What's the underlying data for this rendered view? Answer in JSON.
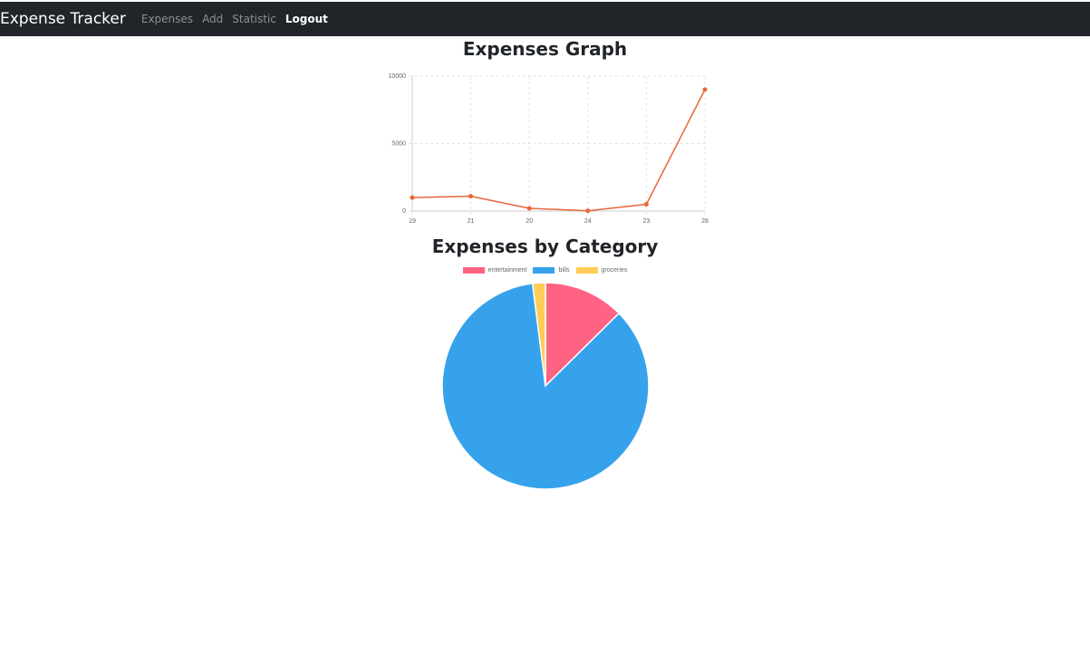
{
  "navbar": {
    "brand": "Expense Tracker",
    "links": [
      {
        "label": "Expenses"
      },
      {
        "label": "Add"
      },
      {
        "label": "Statistic"
      },
      {
        "label": "Logout"
      }
    ],
    "bg_color": "#212529"
  },
  "line_section": {
    "title": "Expenses Graph"
  },
  "pie_section": {
    "title": "Expenses by Category"
  },
  "chart_data": [
    {
      "type": "line",
      "title": "Expenses Graph",
      "x": [
        "19",
        "21",
        "20",
        "24",
        "23",
        "28"
      ],
      "series": [
        {
          "values": [
            1000,
            1100,
            200,
            20,
            500,
            9000
          ],
          "color": "#e8663a"
        }
      ],
      "ylim": [
        0,
        10000
      ],
      "yticks": [
        "0",
        "5000",
        "10000"
      ],
      "grid": true
    },
    {
      "type": "pie",
      "title": "Expenses by Category",
      "labels": [
        "entertainment",
        "bills",
        "groceries"
      ],
      "values": [
        12.6,
        85.4,
        2.0
      ],
      "colors": [
        "#ff6384",
        "#36a2eb",
        "#ffcd56"
      ],
      "legend": "top"
    }
  ]
}
